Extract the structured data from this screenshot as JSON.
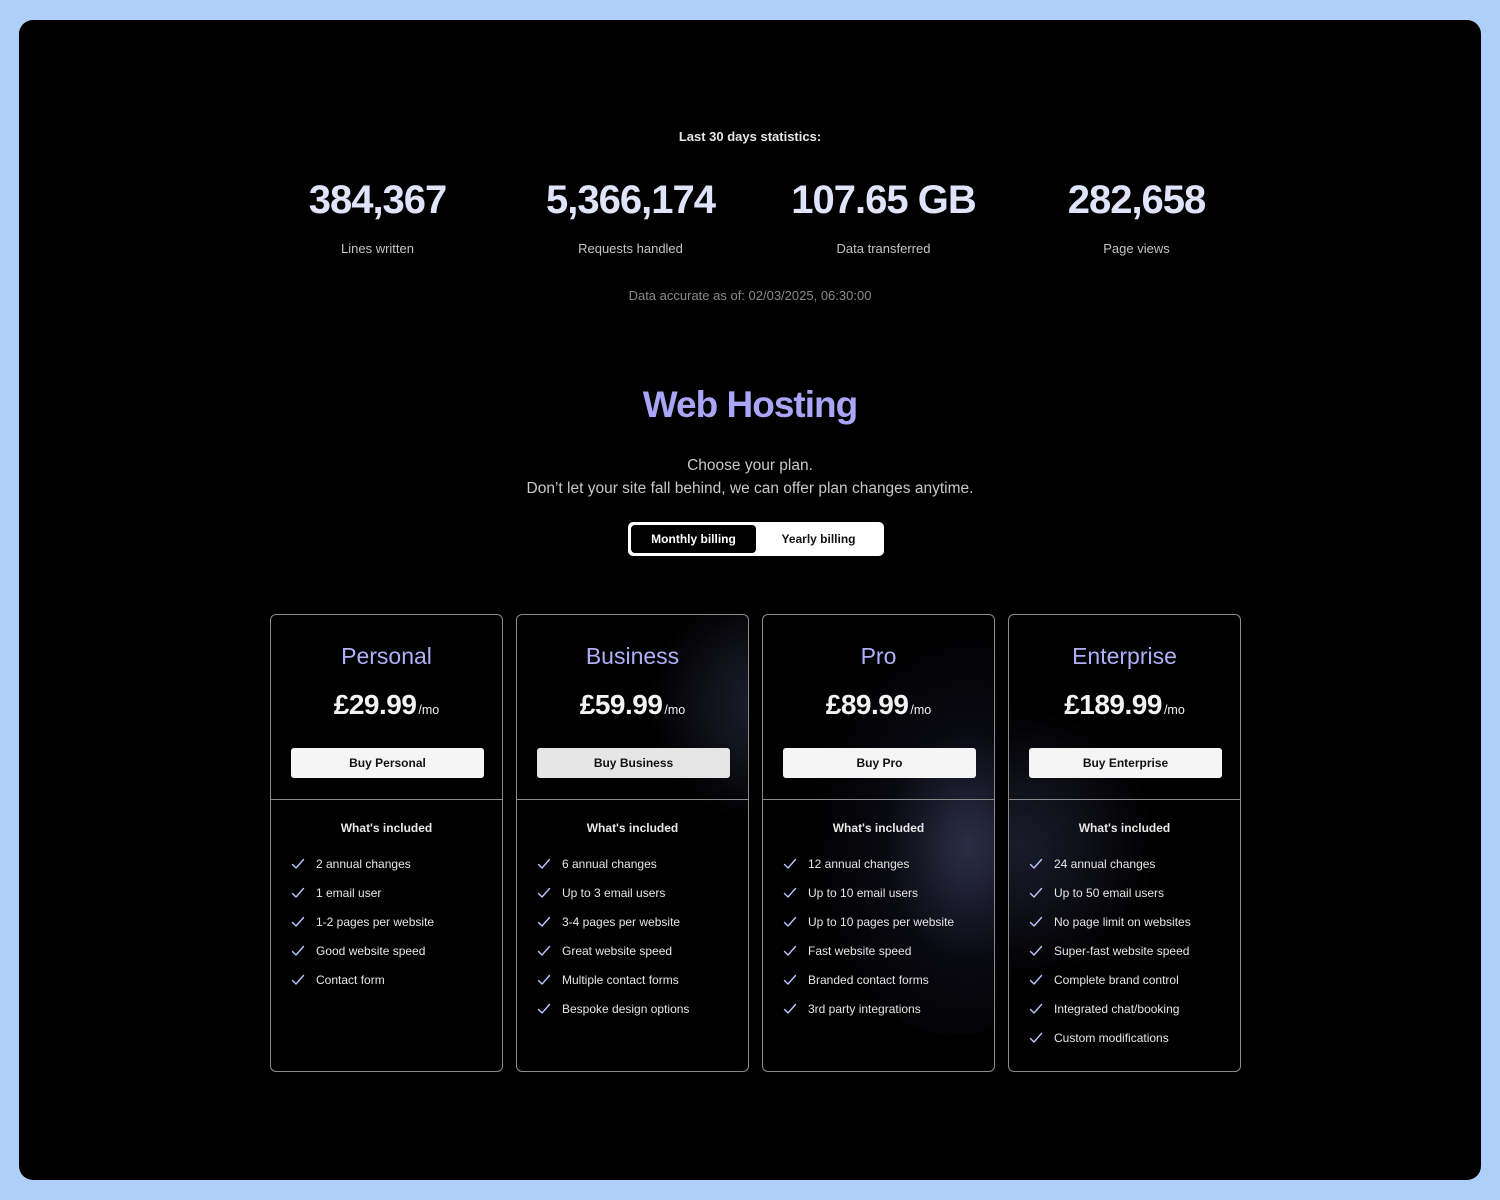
{
  "stats": {
    "heading": "Last 30 days statistics:",
    "items": [
      {
        "value": "384,367",
        "label": "Lines written"
      },
      {
        "value": "5,366,174",
        "label": "Requests handled"
      },
      {
        "value": "107.65 GB",
        "label": "Data transferred"
      },
      {
        "value": "282,658",
        "label": "Page views"
      }
    ],
    "accuracy": "Data accurate as of: 02/03/2025, 06:30:00"
  },
  "hosting": {
    "title": "Web Hosting",
    "subtitle_line1": "Choose your plan.",
    "subtitle_line2": "Don’t let your site fall behind, we can offer plan changes anytime."
  },
  "billing": {
    "monthly_label": "Monthly billing",
    "yearly_label": "Yearly billing",
    "selected": "Monthly billing"
  },
  "colors": {
    "accent": "#a9a6f8",
    "stat_value": "#dfe4fb",
    "background": "#000000",
    "page_border": "#aed0f8"
  },
  "plans": [
    {
      "name": "Personal",
      "price": "£29.99",
      "unit": "/mo",
      "button": "Buy Personal",
      "included_label": "What's included",
      "features": [
        "2 annual changes",
        "1 email user",
        "1-2 pages per website",
        "Good website speed",
        "Contact form"
      ]
    },
    {
      "name": "Business",
      "price": "£59.99",
      "unit": "/mo",
      "button": "Buy Business",
      "included_label": "What's included",
      "features": [
        "6 annual changes",
        "Up to 3 email users",
        "3-4 pages per website",
        "Great website speed",
        "Multiple contact forms",
        "Bespoke design options"
      ]
    },
    {
      "name": "Pro",
      "price": "£89.99",
      "unit": "/mo",
      "button": "Buy Pro",
      "included_label": "What's included",
      "features": [
        "12 annual changes",
        "Up to 10 email users",
        "Up to 10 pages per website",
        "Fast website speed",
        "Branded contact forms",
        "3rd party integrations"
      ]
    },
    {
      "name": "Enterprise",
      "price": "£189.99",
      "unit": "/mo",
      "button": "Buy Enterprise",
      "included_label": "What's included",
      "features": [
        "24 annual changes",
        "Up to 50 email users",
        "No page limit on websites",
        "Super-fast website speed",
        "Complete brand control",
        "Integrated chat/booking",
        "Custom modifications"
      ]
    }
  ]
}
